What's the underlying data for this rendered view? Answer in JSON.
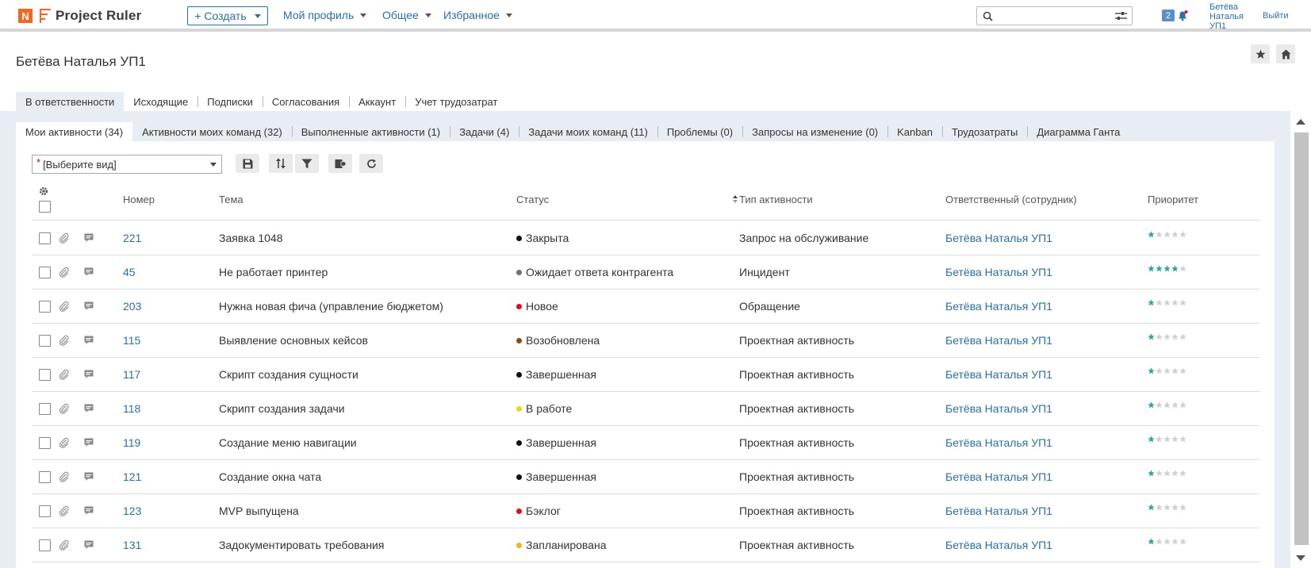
{
  "app": {
    "logo_letter": "N",
    "name": "Project Ruler"
  },
  "topbar": {
    "create_label": "+ Создать",
    "nav": [
      {
        "label": "Мой профиль"
      },
      {
        "label": "Общее"
      },
      {
        "label": "Избранное"
      }
    ],
    "search_placeholder": "",
    "notification_count": "2",
    "user_line1": "Бетёва",
    "user_line2": "Наталья",
    "user_line3": "УП1",
    "logout_label": "Выйти"
  },
  "page": {
    "title": "Бетёва Наталья УП1"
  },
  "main_tabs": [
    {
      "label": "В ответственности",
      "active": true
    },
    {
      "label": "Исходящие"
    },
    {
      "label": "Подписки"
    },
    {
      "label": "Согласования"
    },
    {
      "label": "Аккаунт"
    },
    {
      "label": "Учет трудозатрат"
    }
  ],
  "sub_tabs": [
    {
      "label": "Мои активности (34)",
      "active": true
    },
    {
      "label": "Активности моих команд (32)"
    },
    {
      "label": "Выполненные активности (1)"
    },
    {
      "label": "Задачи (4)"
    },
    {
      "label": "Задачи моих команд (11)"
    },
    {
      "label": "Проблемы (0)"
    },
    {
      "label": "Запросы на изменение (0)"
    },
    {
      "label": "Kanban"
    },
    {
      "label": "Трудозатраты"
    },
    {
      "label": "Диаграмма Ганта"
    }
  ],
  "toolbar": {
    "view_required_mark": "*",
    "view_placeholder": "[Выберите вид]"
  },
  "table": {
    "headers": {
      "number": "Номер",
      "subject": "Тема",
      "status": "Статус",
      "type": "Тип активности",
      "assignee": "Ответственный (сотрудник)",
      "priority": "Приоритет"
    },
    "rows": [
      {
        "number": "221",
        "subject": "Заявка 1048",
        "status": "Закрыта",
        "status_color": "#111111",
        "type": "Запрос на обслуживание",
        "assignee": "Бетёва Наталья УП1",
        "priority": 1
      },
      {
        "number": "45",
        "subject": "Не работает принтер",
        "status": "Ожидает ответа контрагента",
        "status_color": "#6b6f80",
        "type": "Инцидент",
        "assignee": "Бетёва Наталья УП1",
        "priority": 4
      },
      {
        "number": "203",
        "subject": "Нужна новая фича (управление бюджетом)",
        "status": "Новое",
        "status_color": "#e0101a",
        "type": "Обращение",
        "assignee": "Бетёва Наталья УП1",
        "priority": 1
      },
      {
        "number": "115",
        "subject": "Выявление основных кейсов",
        "status": "Возобновлена",
        "status_color": "#8a4a10",
        "type": "Проектная активность",
        "assignee": "Бетёва Наталья УП1",
        "priority": 1
      },
      {
        "number": "117",
        "subject": "Скрипт создания сущности",
        "status": "Завершенная",
        "status_color": "#111111",
        "type": "Проектная активность",
        "assignee": "Бетёва Наталья УП1",
        "priority": 1
      },
      {
        "number": "118",
        "subject": "Скрипт создания задачи",
        "status": "В работе",
        "status_color": "#f2d21a",
        "type": "Проектная активность",
        "assignee": "Бетёва Наталья УП1",
        "priority": 1
      },
      {
        "number": "119",
        "subject": "Создание меню навигации",
        "status": "Завершенная",
        "status_color": "#111111",
        "type": "Проектная активность",
        "assignee": "Бетёва Наталья УП1",
        "priority": 1
      },
      {
        "number": "121",
        "subject": "Создание окна чата",
        "status": "Завершенная",
        "status_color": "#111111",
        "type": "Проектная активность",
        "assignee": "Бетёва Наталья УП1",
        "priority": 1
      },
      {
        "number": "123",
        "subject": "MVP выпущена",
        "status": "Бэклог",
        "status_color": "#e0101a",
        "type": "Проектная активность",
        "assignee": "Бетёва Наталья УП1",
        "priority": 1
      },
      {
        "number": "131",
        "subject": "Задокументировать требования",
        "status": "Запланирована",
        "status_color": "#f5b21a",
        "type": "Проектная активность",
        "assignee": "Бетёва Наталья УП1",
        "priority": 1
      }
    ]
  },
  "colors": {
    "accent": "#2a6ea6",
    "brand": "#f26722",
    "star_filled": "#2aa9a0",
    "star_empty": "#d0d0d0"
  }
}
